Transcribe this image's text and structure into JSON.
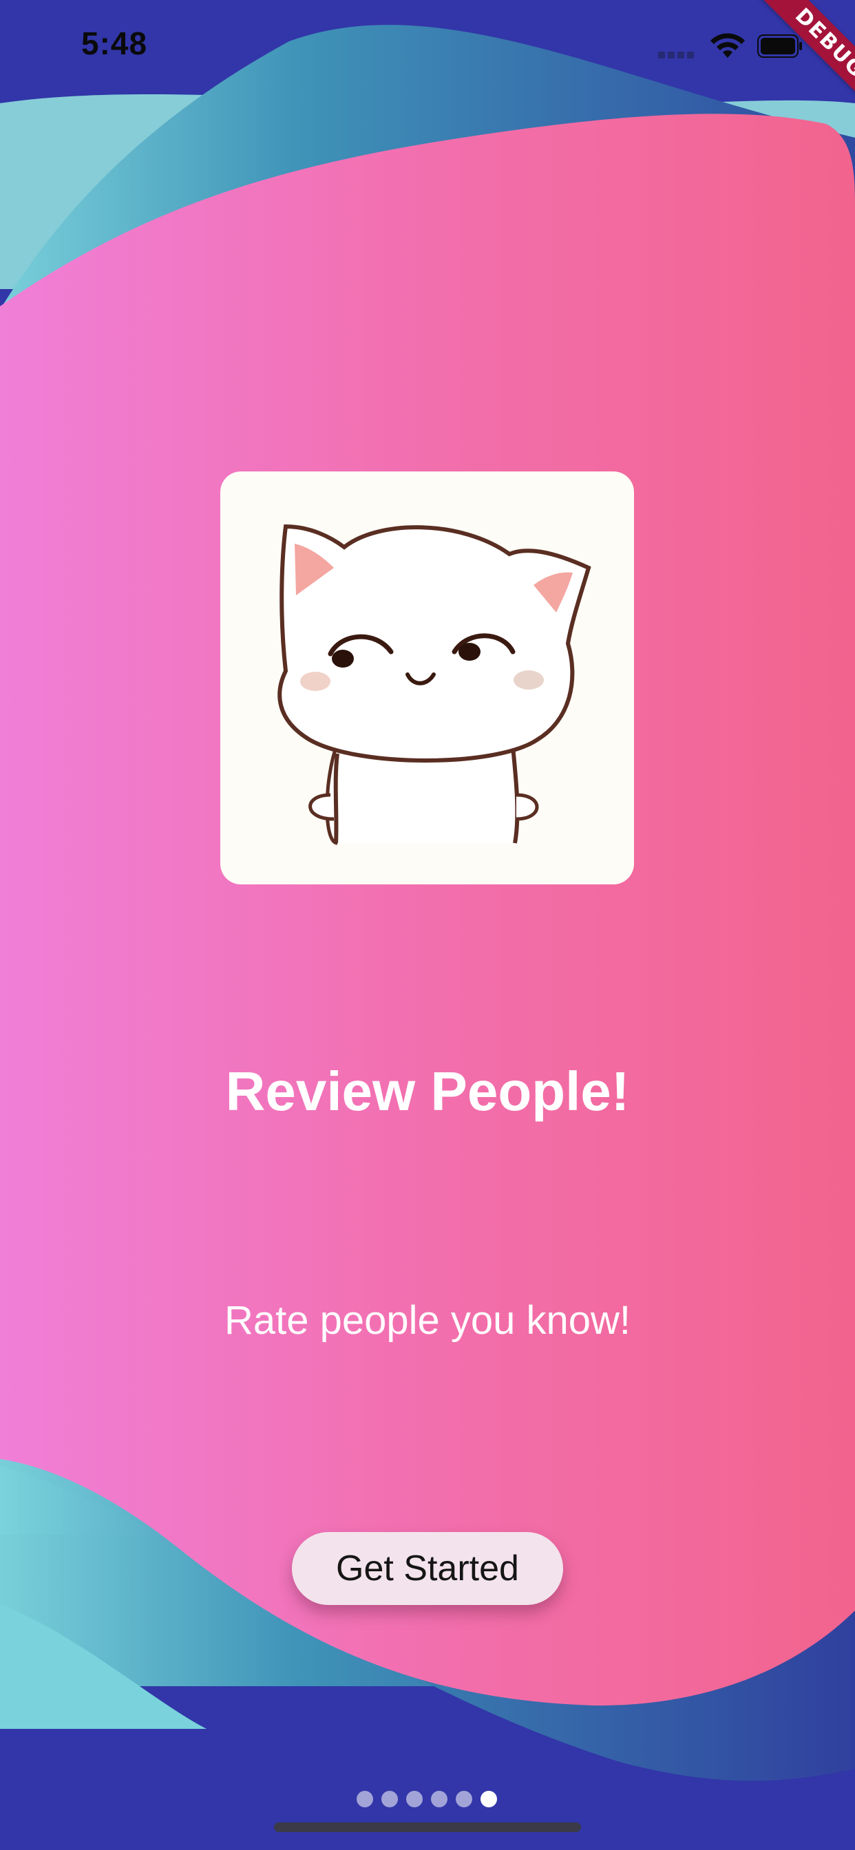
{
  "status_bar": {
    "time": "5:48",
    "signal_icon": "cellular-signal-icon",
    "wifi_icon": "wifi-icon",
    "battery_icon": "battery-icon"
  },
  "debug_banner": {
    "label": "DEBUG"
  },
  "onboarding": {
    "illustration": "cat-illustration",
    "title": "Review People!",
    "subtitle": "Rate people you know!",
    "cta_label": "Get Started"
  },
  "pagination": {
    "total": 6,
    "active_index": 5
  },
  "colors": {
    "background_navy": "#3236a8",
    "wave_teal": "#3a8db0",
    "gradient_start": "#f07fd6",
    "gradient_end": "#f26590",
    "button_bg": "#f3e3ec",
    "debug_banner": "#a3133a"
  }
}
